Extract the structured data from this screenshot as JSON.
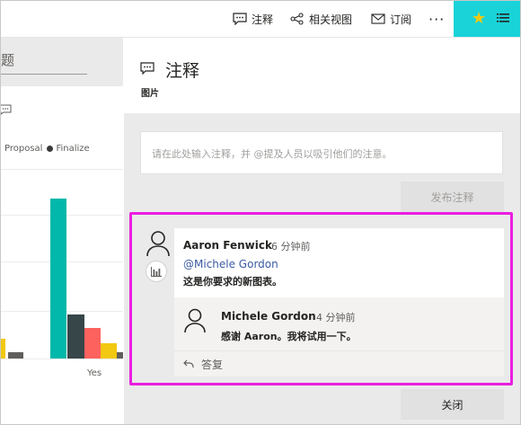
{
  "topbar": {
    "comment_label": "注释",
    "related_label": "相关视图",
    "subscribe_label": "订阅",
    "more_label": "···",
    "accent_color": "#19d3d8",
    "star_color": "#f2c811"
  },
  "report": {
    "title_partial": "题",
    "chart_data": {
      "type": "bar",
      "legend": [
        "Proposal",
        "Finalize"
      ],
      "categories": [
        "Yes"
      ],
      "series_colors": [
        "#f2c811",
        "#605e5c",
        "#01b8aa",
        "#374649",
        "#fd625e"
      ]
    }
  },
  "pane": {
    "title": "注释",
    "subtitle": "图片",
    "input_placeholder": "请在此处输入注释，并 @提及人员以吸引他们的注意。",
    "post_label": "发布注释",
    "close_label": "关闭"
  },
  "thread": {
    "comment1": {
      "author": "Aaron Fenwick",
      "time": "6 分钟前",
      "mention": "@Michele Gordon",
      "text": "这是你要求的新图表。"
    },
    "comment2": {
      "author": "Michele Gordon",
      "time": "4 分钟前",
      "text": "感谢 Aaron。我将试用一下。"
    },
    "reply_label": "答复"
  },
  "highlight_color": "#ea1ee0"
}
